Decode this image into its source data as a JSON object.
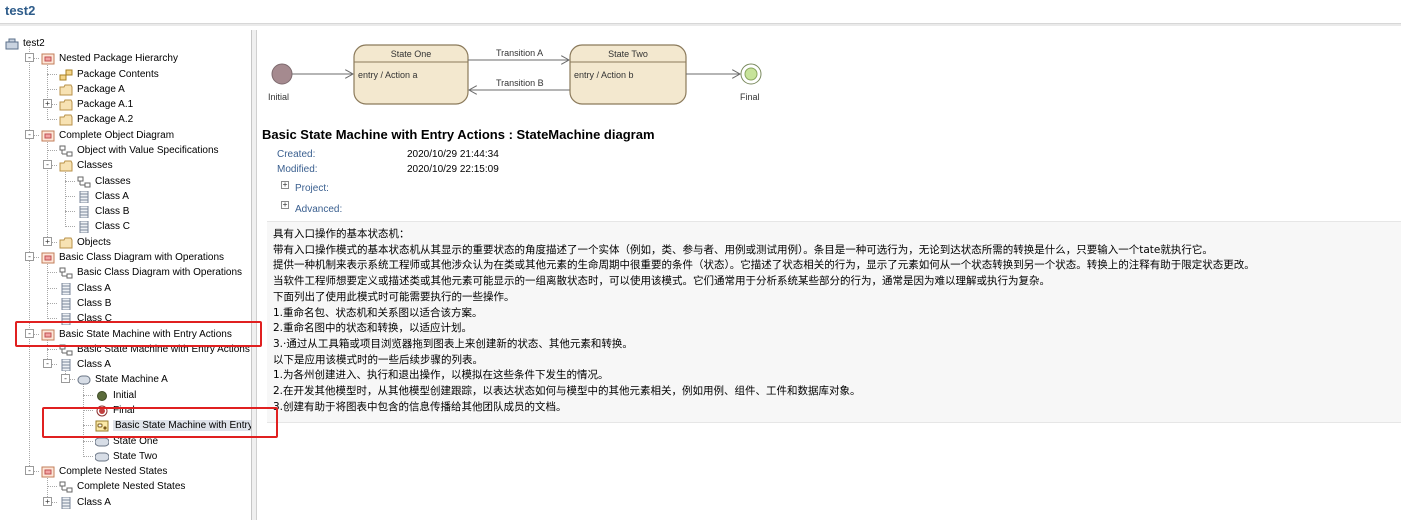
{
  "window": {
    "title": "test2"
  },
  "tree": {
    "items": [
      {
        "label": "test2",
        "icon": "model-root-icon"
      },
      {
        "label": "Nested Package Hierarchy",
        "icon": "package-diagram-folder-icon"
      },
      {
        "label": "Package Contents",
        "icon": "package-diagram-icon"
      },
      {
        "label": "Package A",
        "icon": "folder-icon"
      },
      {
        "label": "Package A.1",
        "icon": "folder-icon"
      },
      {
        "label": "Package A.2",
        "icon": "folder-icon"
      },
      {
        "label": "Complete Object Diagram",
        "icon": "package-diagram-folder-icon"
      },
      {
        "label": "Object with Value Specifications",
        "icon": "class-diagram-icon"
      },
      {
        "label": "Classes",
        "icon": "folder-icon"
      },
      {
        "label": "Classes",
        "icon": "class-diagram-icon"
      },
      {
        "label": "Class A",
        "icon": "class-icon"
      },
      {
        "label": "Class B",
        "icon": "class-icon"
      },
      {
        "label": "Class C",
        "icon": "class-icon"
      },
      {
        "label": "Objects",
        "icon": "folder-icon"
      },
      {
        "label": "Basic Class Diagram with Operations",
        "icon": "package-diagram-folder-icon"
      },
      {
        "label": "Basic Class Diagram with Operations",
        "icon": "class-diagram-icon"
      },
      {
        "label": "Class A",
        "icon": "class-icon"
      },
      {
        "label": "Class B",
        "icon": "class-icon"
      },
      {
        "label": "Class C",
        "icon": "class-icon"
      },
      {
        "label": "Basic State Machine with Entry Actions",
        "icon": "package-diagram-folder-icon"
      },
      {
        "label": "Basic State Machine with Entry Actions",
        "icon": "class-diagram-icon"
      },
      {
        "label": "Class A",
        "icon": "class-icon"
      },
      {
        "label": "State Machine A",
        "icon": "state-machine-icon"
      },
      {
        "label": "Initial",
        "icon": "initial-node-icon"
      },
      {
        "label": "Final",
        "icon": "final-node-icon"
      },
      {
        "label": "Basic State Machine with Entry Actions",
        "icon": "statemachine-diagram-icon"
      },
      {
        "label": "State One",
        "icon": "state-icon"
      },
      {
        "label": "State Two",
        "icon": "state-icon"
      },
      {
        "label": "Complete Nested States",
        "icon": "package-diagram-folder-icon"
      },
      {
        "label": "Complete Nested States",
        "icon": "class-diagram-icon"
      },
      {
        "label": "Class A",
        "icon": "class-icon"
      }
    ]
  },
  "diagram": {
    "initial_label": "Initial",
    "final_label": "Final",
    "state_one": {
      "name": "State One",
      "action": "entry / Action a"
    },
    "state_two": {
      "name": "State Two",
      "action": "entry / Action b"
    },
    "transition_a": "Transition A",
    "transition_b": "Transition B"
  },
  "details": {
    "title": "Basic State Machine with Entry Actions : StateMachine diagram",
    "created_label": "Created:",
    "created_value": "2020/10/29 21:44:34",
    "modified_label": "Modified:",
    "modified_value": "2020/10/29 22:15:09",
    "project_label": "Project:",
    "advanced_label": "Advanced:"
  },
  "notes": [
    "具有入口操作的基本状态机：",
    "带有入口操作模式的基本状态机从其显示的重要状态的角度描述了一个实体（例如，类、参与者、用例或测试用例）。条目是一种可选行为，无论到达状态所需的转换是什么，只要输入一个tate就执行它。",
    "提供一种机制来表示系统工程师或其他涉众认为在类或其他元素的生命周期中很重要的条件（状态）。它描述了状态相关的行为，显示了元素如何从一个状态转换到另一个状态。转换上的注释有助于限定状态更改。",
    "当软件工程师想要定义或描述类或其他元素可能显示的一组离散状态时，可以使用该模式。它们通常用于分析系统某些部分的行为，通常是因为难以理解或执行为复杂。",
    "下面列出了使用此模式时可能需要执行的一些操作。",
    "1.重命名包、状态机和关系图以适合该方案。",
    "2.重命名图中的状态和转换，以适应计划。",
    "3.·通过从工具箱或项目浏览器拖到图表上来创建新的状态、其他元素和转换。",
    "以下是应用该模式时的一些后续步骤的列表。",
    "1.为各州创建进入、执行和退出操作，以模拟在这些条件下发生的情况。",
    "2.在开发其他模型时，从其他模型创建跟踪，以表达状态如何与模型中的其他元素相关，例如用例、组件、工件和数据库对象。",
    "3.创建有助于将图表中包含的信息传播给其他团队成员的文档。"
  ],
  "colors": {
    "state_fill": "#f3e8cf",
    "state_border": "#8b7a5b",
    "initial_fill": "#a58a8f",
    "final_fill": "#c7e39a",
    "highlight": "#e02020",
    "meta_label": "#3a5f8f"
  }
}
